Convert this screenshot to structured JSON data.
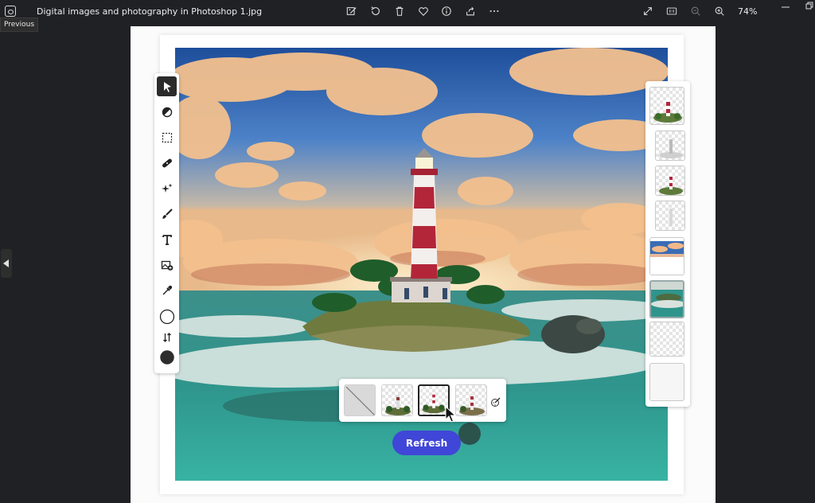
{
  "window": {
    "title": "Digital images and photography in Photoshop 1.jpg",
    "tooltip": "Previous",
    "zoom_level": "74%"
  },
  "toolbar": {
    "icons": [
      "edit-image-icon",
      "rotate-icon",
      "delete-icon",
      "favorite-icon",
      "info-icon",
      "share-icon",
      "more-icon"
    ],
    "right_icons": [
      "expand-icon",
      "actual-size-icon",
      "zoom-out-icon",
      "zoom-in-icon"
    ]
  },
  "editor": {
    "tools": [
      "select-icon",
      "adjust-icon",
      "marquee-icon",
      "heal-icon",
      "generative-fill-icon",
      "brush-icon",
      "text-icon",
      "add-image-icon",
      "eyedropper-icon",
      "foreground-color-swatch",
      "swap-colors-icon",
      "background-color-swatch"
    ],
    "refresh_label": "Refresh",
    "accent_color": "#4046d7"
  }
}
